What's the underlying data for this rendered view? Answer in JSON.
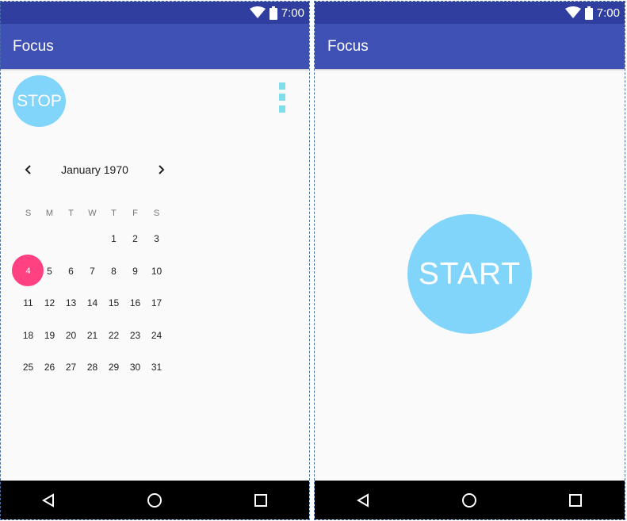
{
  "status_bar": {
    "time": "7:00",
    "icons": [
      "wifi-icon",
      "battery-icon"
    ],
    "color": "#303f9f"
  },
  "app_bar": {
    "title": "Focus",
    "color": "#3f51b5"
  },
  "left_screen": {
    "stop_label": "STOP",
    "stop_color": "#81d4fa",
    "overflow_icon": "more-vert-icon",
    "calendar": {
      "month_label": "January 1970",
      "prev_icon": "chevron-left-icon",
      "next_icon": "chevron-right-icon",
      "weekdays": [
        "S",
        "M",
        "T",
        "W",
        "T",
        "F",
        "S"
      ],
      "weeks": [
        [
          "",
          "",
          "",
          "",
          "1",
          "2",
          "3"
        ],
        [
          "4",
          "5",
          "6",
          "7",
          "8",
          "9",
          "10"
        ],
        [
          "11",
          "12",
          "13",
          "14",
          "15",
          "16",
          "17"
        ],
        [
          "18",
          "19",
          "20",
          "21",
          "22",
          "23",
          "24"
        ],
        [
          "25",
          "26",
          "27",
          "28",
          "29",
          "30",
          "31"
        ]
      ],
      "selected_day": "4",
      "selected_color": "#ff4081"
    }
  },
  "right_screen": {
    "start_label": "START",
    "start_color": "#81d4fa"
  },
  "nav_bar": {
    "buttons": [
      "back-icon",
      "home-icon",
      "recents-icon"
    ]
  }
}
